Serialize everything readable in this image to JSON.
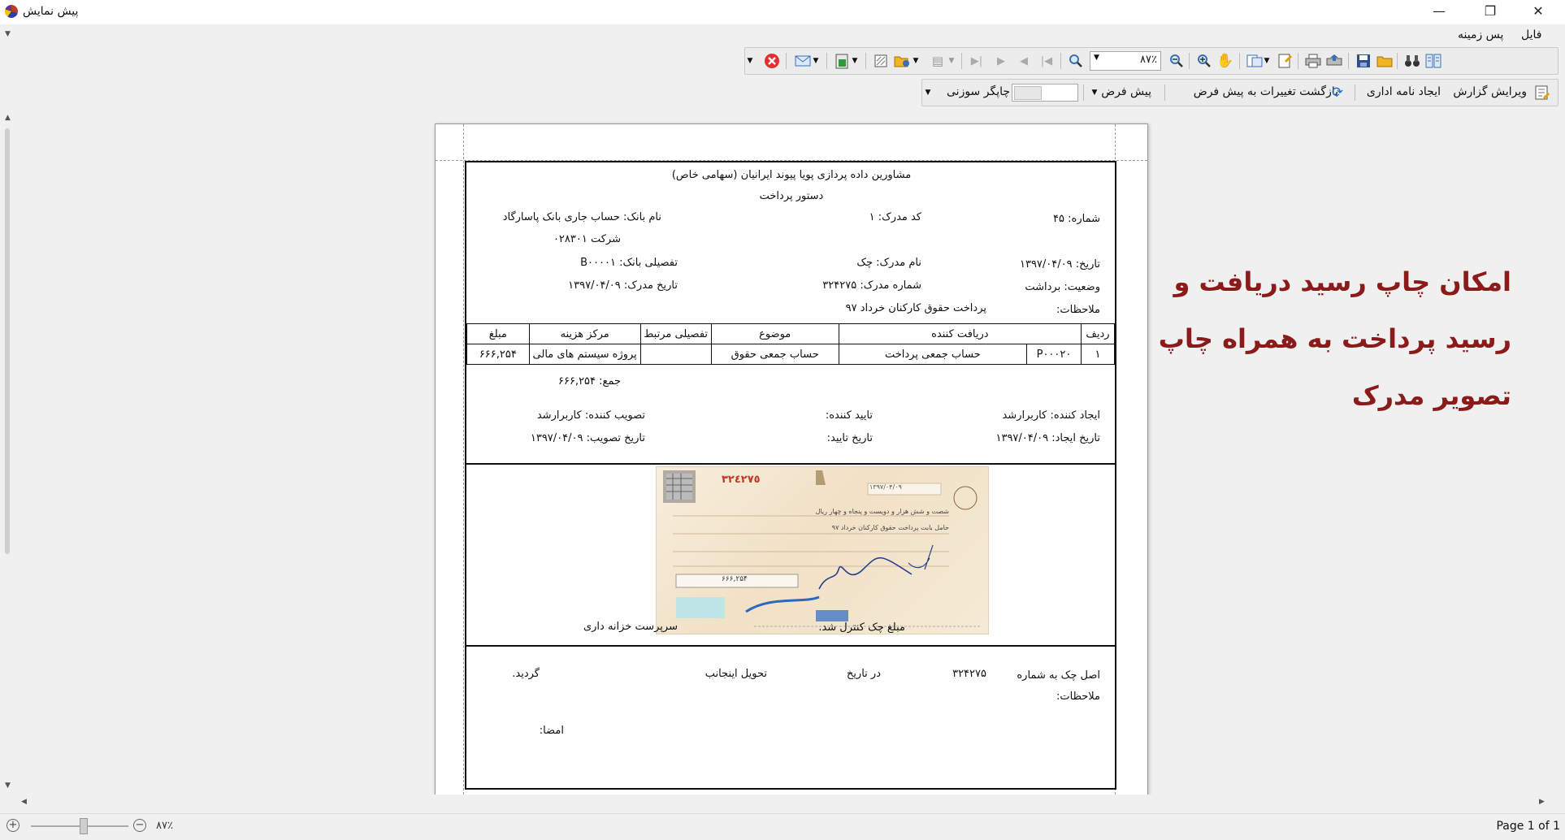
{
  "window": {
    "title": "پیش نمایش",
    "minimize": "—",
    "maximize": "❐",
    "close": "✕"
  },
  "menu": {
    "file": "فایل",
    "background": "پس زمینه"
  },
  "toolbar1": {
    "zoom_value": "۸۷٪",
    "icons": [
      "layout-icon",
      "binoculars-icon",
      "open-folder-icon",
      "save-icon",
      "export-icon",
      "print-icon",
      "page-setup-icon",
      "page-layout-icon",
      "hand-icon",
      "zoom-in-icon",
      "zoom-out-icon",
      "zoom-icon",
      "first-page-icon",
      "previous-page-icon",
      "next-page-icon",
      "last-page-icon",
      "multipage-icon",
      "open-icon",
      "watermark-icon",
      "export-doc-icon",
      "email-icon",
      "close-preview-icon"
    ]
  },
  "toolbar2": {
    "edit_report": "ویرایش گزارش",
    "create_letter": "ایجاد نامه اداری",
    "revert_default": "بازگشت تغییرات به پیش فرض",
    "default": "پیش فرض",
    "dot_matrix": "چاپگر سوزنی"
  },
  "report": {
    "company": "مشاورین داده پردازی پویا پیوند ایرانیان (سهامی خاص)",
    "doc_title": "دستور پرداخت",
    "number": "شماره: ۴۵",
    "doc_code": "کد مدرک: ۱",
    "bank_name_line1": "نام بانک: حساب جاری  بانک پاسارگاد",
    "bank_name_line2": "شرکت ۰۲۸۳۰۱",
    "date": "تاریخ: ۱۳۹۷/۰۴/۰۹",
    "doc_name": "نام مدرک: چک",
    "bank_detail": "تفصیلی بانک: B۰۰۰۰۱",
    "status": "وضعیت: برداشت",
    "doc_number": "شماره مدرک: ۳۲۴۲۷۵",
    "doc_date": "تاریخ مدرک: ۱۳۹۷/۰۴/۰۹",
    "notes_label": "ملاحظات:",
    "notes_value": "پرداخت حقوق کارکنان خرداد ۹۷",
    "table_headers": [
      "ردیف",
      "دریافت کننده",
      "",
      "موضوع",
      "تفصیلی مرتبط",
      "مرکز هزینه",
      "مبلغ"
    ],
    "table_rows": [
      [
        "۱",
        "P۰۰۰۲۰",
        "حساب جمعی پرداخت",
        "حساب جمعی حقوق",
        "",
        "پروژه سیستم های مالی",
        "۶۶۶,۲۵۴"
      ]
    ],
    "total": "جمع: ۶۶۶,۲۵۴",
    "created_by": "ایجاد کننده: کاربرارشد",
    "confirmed_by": "تایید کننده:",
    "approved_by": "تصویب کننده: کاربرارشد",
    "created_date": "تاریخ ایجاد: ۱۳۹۷/۰۴/۰۹",
    "confirmed_date": "تاریخ تایید:",
    "approved_date": "تاریخ تصویب: ۱۳۹۷/۰۴/۰۹",
    "cheque_controlled": "مبلغ چک کنترل شد.",
    "treasury_head": "سرپرست خزانه داری",
    "original_cheque": "اصل چک به شماره",
    "cheque_number": "۳۲۴۲۷۵",
    "on_date": "در تاریخ",
    "delivered_to_me": "تحویل اینجانب",
    "became": "گردید.",
    "footer_notes": "ملاحظات:",
    "signature": "امضا:"
  },
  "cheque_image": {
    "serial": "۳۲٤٢٧٥",
    "date": "۱۳۹۷/۰۴/۰۹",
    "amount_words": "شصت و شش هزار و دویست و پنجاه و چهار ریال",
    "amount": "۶۶۶,۲۵۴",
    "reason": "حامل بابت پرداخت حقوق کارکنان خرداد ۹۷"
  },
  "promo": {
    "line1": "امکان چاپ رسید دریافت و",
    "line2": "رسید پرداخت به همراه چاپ",
    "line3": "تصویر مدرک"
  },
  "status": {
    "zoom": "۸۷٪",
    "page": "Page 1 of 1"
  }
}
